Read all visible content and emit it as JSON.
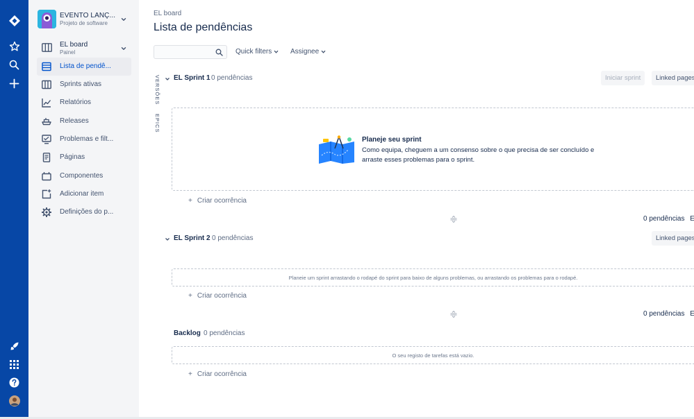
{
  "project": {
    "name": "EVENTO LANÇ...",
    "type": "Projeto de software"
  },
  "board": {
    "name": "EL board",
    "subtitle": "Painel"
  },
  "sidebar": {
    "items": [
      {
        "label": "Lista de pendê...",
        "icon": "backlog-icon",
        "active": true
      },
      {
        "label": "Sprints ativas",
        "icon": "board-columns-icon"
      },
      {
        "label": "Relatórios",
        "icon": "chart-line-icon"
      },
      {
        "label": "Releases",
        "icon": "ship-icon"
      },
      {
        "label": "Problemas e filt...",
        "icon": "issues-filter-icon"
      },
      {
        "label": "Páginas",
        "icon": "page-icon"
      },
      {
        "label": "Componentes",
        "icon": "component-icon"
      },
      {
        "label": "Adicionar item",
        "icon": "add-item-icon"
      },
      {
        "label": "Definições do p...",
        "icon": "gear-icon"
      }
    ]
  },
  "header": {
    "breadcrumb": "EL board",
    "title": "Lista de pendências"
  },
  "toolbar": {
    "quick_filters": "Quick filters",
    "assignee": "Assignee"
  },
  "vertical_tabs": {
    "versions": "VERSÕES",
    "epics": "EPICS"
  },
  "sprint1": {
    "name": "EL Sprint 1",
    "count": "0 pendências",
    "start_button": "Iniciar sprint",
    "linked_pages": "Linked pages",
    "empty_title": "Planeje seu sprint",
    "empty_text": "Como equipa, cheguem a um consenso sobre o que precisa de ser concluído e arraste esses problemas para o sprint.",
    "create": "Criar ocorrência",
    "footer_count": "0 pendências",
    "footer_extra": "Es"
  },
  "sprint2": {
    "name": "EL Sprint 2",
    "count": "0 pendências",
    "linked_pages": "Linked pages",
    "empty_text": "Planeie um sprint arrastando o rodapé do sprint para baixo de alguns problemas, ou arrastando os problemas para o rodapé.",
    "create": "Criar ocorrência",
    "footer_count": "0 pendências",
    "footer_extra": "Es"
  },
  "backlog": {
    "name": "Backlog",
    "count": "0 pendências",
    "empty_text": "O seu registo de tarefas está vazio.",
    "create": "Criar ocorrência"
  },
  "colors": {
    "global_nav": "#0747A6",
    "sidebar_bg": "#F4F5F7",
    "active_text": "#0052CC",
    "project_avatar": "#2CB5E0"
  }
}
